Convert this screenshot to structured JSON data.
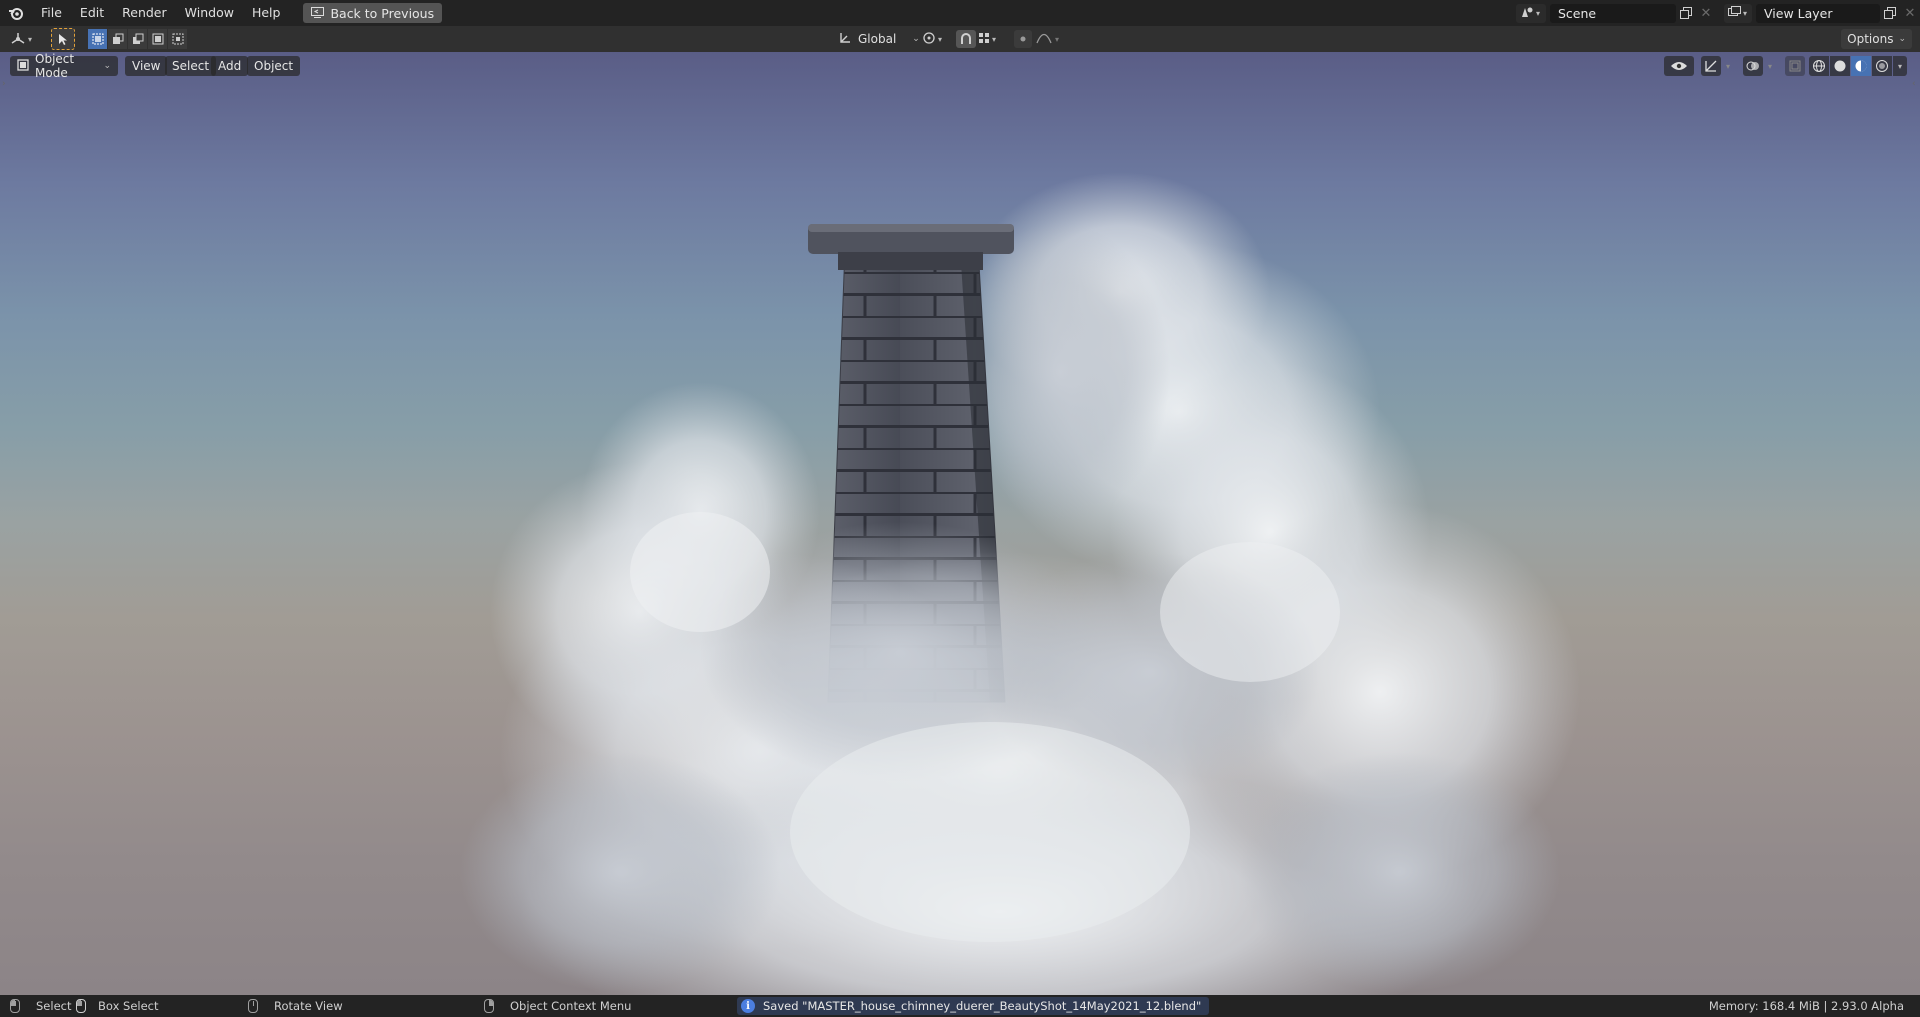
{
  "topbar": {
    "menus": [
      "File",
      "Edit",
      "Render",
      "Window",
      "Help"
    ],
    "back_label": "Back to Previous",
    "scene_name": "Scene",
    "view_layer_name": "View Layer"
  },
  "toolheader": {
    "orientation": "Global",
    "options_label": "Options"
  },
  "viewport": {
    "mode": "Object Mode",
    "menus": [
      "View",
      "Select",
      "Add",
      "Object"
    ]
  },
  "statusbar": {
    "select": "Select",
    "box_select": "Box Select",
    "rotate_view": "Rotate View",
    "context_menu": "Object Context Menu",
    "saved_message": "Saved \"MASTER_house_chimney_duerer_BeautyShot_14May2021_12.blend\"",
    "memory": "Memory: 168.4 MiB | 2.93.0 Alpha"
  },
  "colors": {
    "accent": "#4772b3",
    "active_tool_border": "#e3a23a",
    "info_icon": "#4c7ee0"
  }
}
